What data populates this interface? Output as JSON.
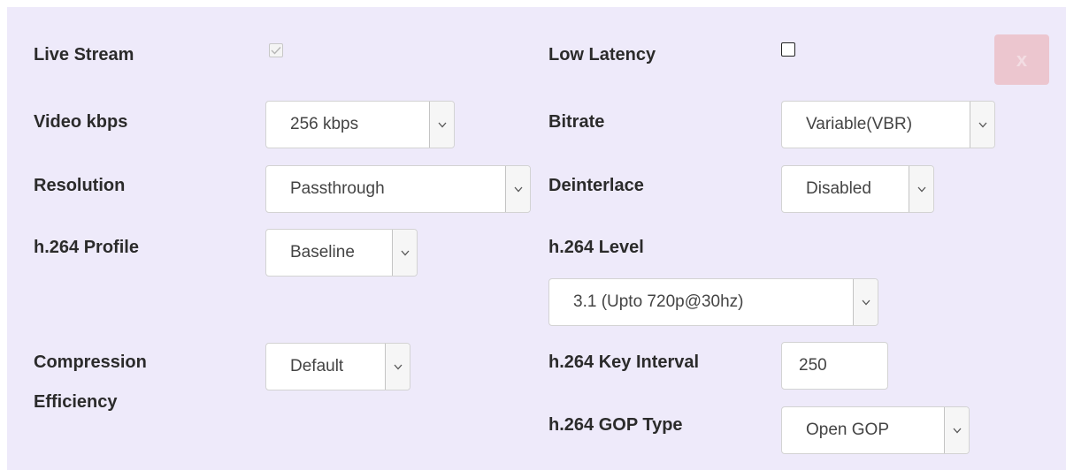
{
  "live_stream": {
    "label": "Live Stream",
    "checked": true
  },
  "low_latency": {
    "label": "Low Latency",
    "checked": false
  },
  "close_button": {
    "label": "x"
  },
  "video_kbps": {
    "label": "Video kbps",
    "value": "256 kbps"
  },
  "bitrate": {
    "label": "Bitrate",
    "value": "Variable(VBR)"
  },
  "resolution": {
    "label": "Resolution",
    "value": "Passthrough"
  },
  "deinterlace": {
    "label": "Deinterlace",
    "value": "Disabled"
  },
  "h264_profile": {
    "label": "h.264 Profile",
    "value": "Baseline"
  },
  "h264_level": {
    "label": "h.264 Level",
    "value": "3.1 (Upto 720p@30hz)"
  },
  "compression": {
    "label_line1": "Compression",
    "label_line2": "Efficiency",
    "value": "Default"
  },
  "key_interval": {
    "label": "h.264 Key Interval",
    "value": "250"
  },
  "gop_type": {
    "label": "h.264 GOP Type",
    "value": "Open GOP"
  },
  "icons": {
    "dropdown": "chevron-down-icon",
    "check": "check-icon",
    "close": "close-icon"
  },
  "colors": {
    "panel_bg": "#eeeafa",
    "close_bg": "#ecc6cf",
    "label_text": "#2b2b2b"
  }
}
